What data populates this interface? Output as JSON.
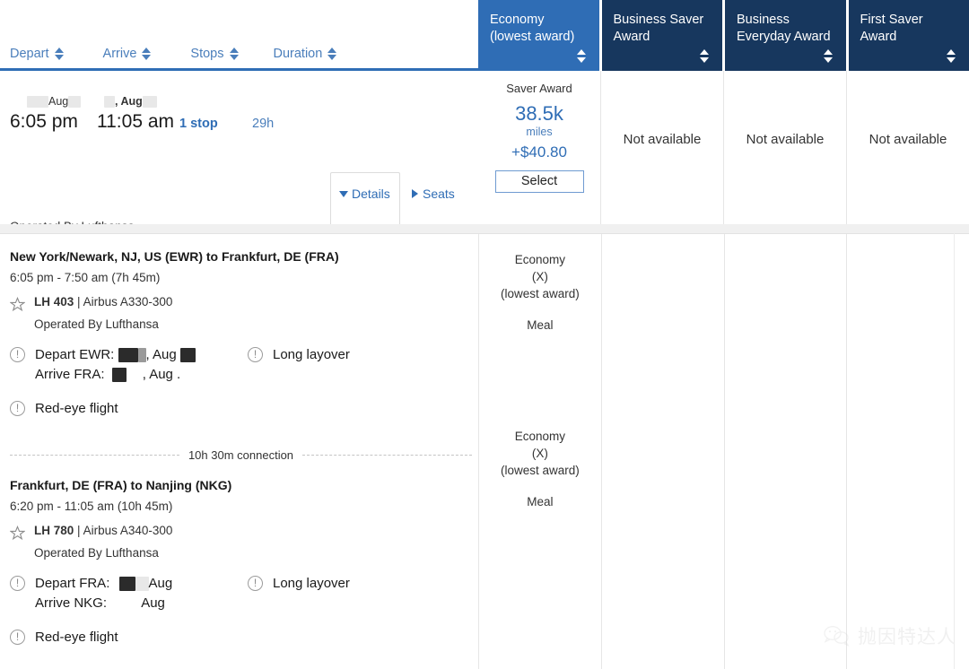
{
  "sort_bar": {
    "items": [
      {
        "label": "Depart",
        "icon": "sort-arrows-icon"
      },
      {
        "label": "Arrive",
        "icon": "sort-arrows-icon"
      },
      {
        "label": "Stops",
        "icon": "sort-arrows-icon"
      },
      {
        "label": "Duration",
        "icon": "sort-arrows-icon"
      }
    ]
  },
  "fare_columns": [
    {
      "label": "Economy\n(lowest award)",
      "active": true
    },
    {
      "label": "Business Saver\nAward",
      "active": false
    },
    {
      "label": "Business\nEveryday Award",
      "active": false
    },
    {
      "label": "First Saver Award",
      "active": false
    }
  ],
  "summary": {
    "depart": {
      "date_prefix": "Aug",
      "time": "6:05 pm"
    },
    "arrive": {
      "date_prefix": ", Aug",
      "time": "11:05 am"
    },
    "stops": "1 stop",
    "duration": "29h",
    "operated_by": "Operated By Lufthansa",
    "details_label": "Details",
    "seats_label": "Seats"
  },
  "fare_cells": [
    {
      "available": true,
      "award_type": "Saver Award",
      "miles": "38.5k",
      "miles_unit": "miles",
      "cash": "+$40.80",
      "select_label": "Select"
    },
    {
      "available": false,
      "not_available": "Not available"
    },
    {
      "available": false,
      "not_available": "Not available"
    },
    {
      "available": false,
      "not_available": "Not available"
    }
  ],
  "segments": [
    {
      "title": "New York/Newark, NJ, US (EWR) to Frankfurt, DE (FRA)",
      "times": "6:05 pm - 7:50 am (7h 45m)",
      "flight_number": "LH 403",
      "aircraft": "Airbus A330-300",
      "separator": "|",
      "operated_by": "Operated By Lufthansa",
      "depart_label": "Depart EWR:",
      "depart_value": ", Aug",
      "arrive_label": "Arrive FRA:",
      "arrive_value": ", Aug .",
      "layover_note": "Long layover",
      "redeye_note": "Red-eye flight",
      "cabin": "Economy\n(X)\n(lowest award)",
      "meal": "Meal"
    },
    {
      "title": "Frankfurt, DE (FRA) to Nanjing (NKG)",
      "times": "6:20 pm - 11:05 am (10h 45m)",
      "flight_number": "LH 780",
      "aircraft": "Airbus A340-300",
      "separator": "|",
      "operated_by": "Operated By Lufthansa",
      "depart_label": "Depart FRA:",
      "depart_value": "Aug",
      "arrive_label": "Arrive NKG:",
      "arrive_value": "Aug",
      "layover_note": "Long layover",
      "redeye_note": "Red-eye flight",
      "cabin": "Economy\n(X)\n(lowest award)",
      "meal": "Meal"
    }
  ],
  "connection": {
    "text": "10h 30m connection"
  },
  "watermark": {
    "text": "抛因特达人",
    "icon": "wechat-icon"
  },
  "colors": {
    "header_active": "#2f6db5",
    "header_inactive": "#17375e",
    "link_blue": "#2f6db5",
    "sort_blue": "#4a7ebb",
    "gap_gray": "#f0f0f0"
  }
}
